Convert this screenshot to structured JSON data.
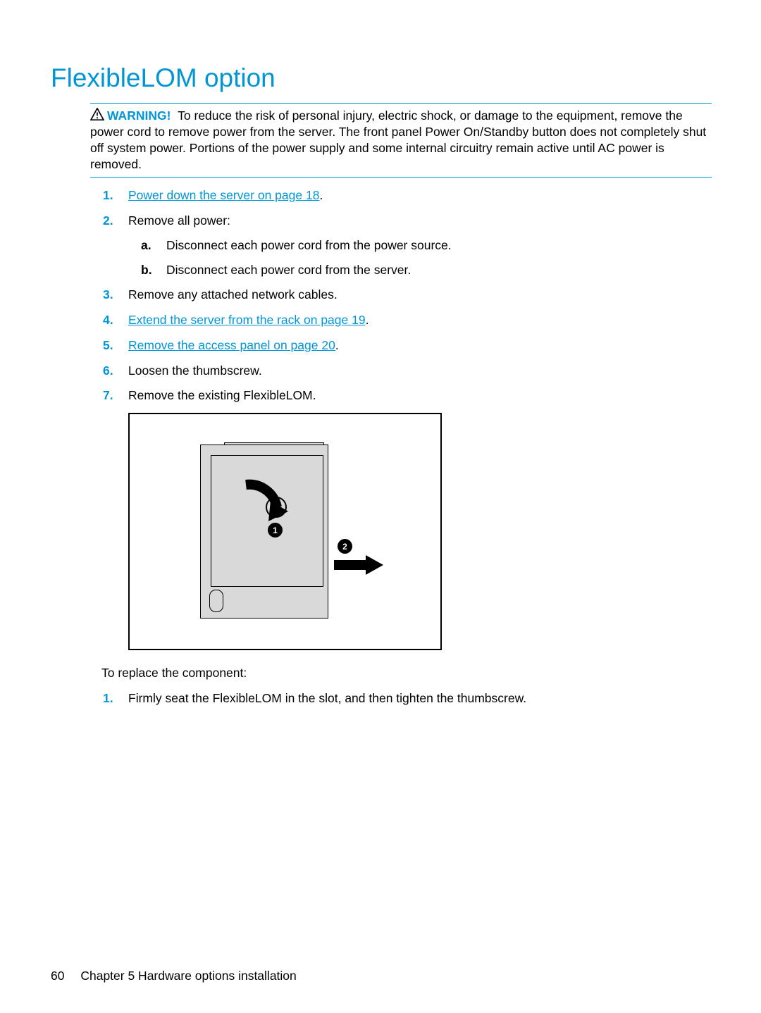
{
  "heading": "FlexibleLOM option",
  "warning": {
    "label": "WARNING!",
    "text": "To reduce the risk of personal injury, electric shock, or damage to the equipment, remove the power cord to remove power from the server. The front panel Power On/Standby button does not completely shut off system power. Portions of the power supply and some internal circuitry remain active until AC power is removed."
  },
  "steps": [
    {
      "link": "Power down the server on page 18",
      "suffix": "."
    },
    {
      "text": "Remove all power:",
      "sub": [
        {
          "marker": "a.",
          "text": "Disconnect each power cord from the power source."
        },
        {
          "marker": "b.",
          "text": "Disconnect each power cord from the server."
        }
      ]
    },
    {
      "text": "Remove any attached network cables."
    },
    {
      "link": "Extend the server from the rack on page 19",
      "suffix": "."
    },
    {
      "link": "Remove the access panel on page 20",
      "suffix": "."
    },
    {
      "text": "Loosen the thumbscrew."
    },
    {
      "text": "Remove the existing FlexibleLOM."
    }
  ],
  "figure": {
    "marker1": "1",
    "marker2": "2"
  },
  "replace_intro": "To replace the component:",
  "replace_steps": [
    {
      "marker": "1.",
      "text": "Firmly seat the FlexibleLOM in the slot, and then tighten the thumbscrew."
    }
  ],
  "footer": {
    "page": "60",
    "chapter": "Chapter 5   Hardware options installation"
  }
}
